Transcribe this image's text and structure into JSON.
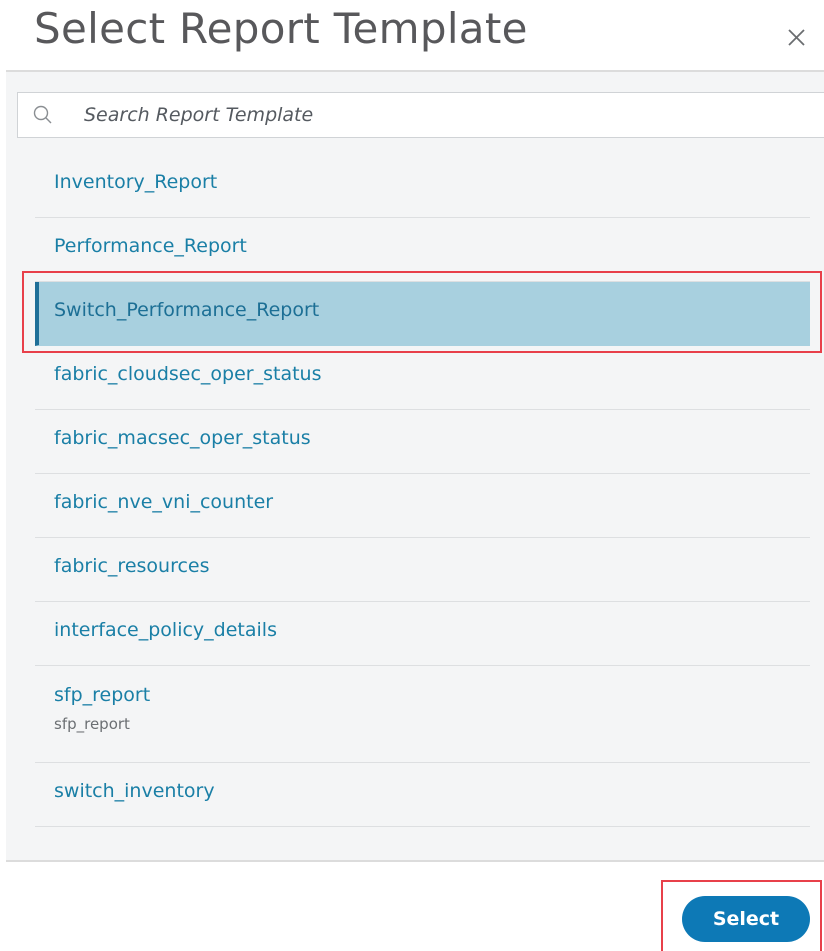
{
  "dialog": {
    "title": "Select Report Template",
    "close_icon": "close-icon"
  },
  "search": {
    "placeholder": "Search Report Template",
    "value": "",
    "icon": "search-icon"
  },
  "templates": [
    {
      "label": "Inventory_Report"
    },
    {
      "label": "Performance_Report"
    },
    {
      "label": "Switch_Performance_Report",
      "selected": true
    },
    {
      "label": "fabric_cloudsec_oper_status"
    },
    {
      "label": "fabric_macsec_oper_status"
    },
    {
      "label": "fabric_nve_vni_counter"
    },
    {
      "label": "fabric_resources"
    },
    {
      "label": "interface_policy_details"
    },
    {
      "label": "sfp_report",
      "description": "sfp_report"
    },
    {
      "label": "switch_inventory"
    }
  ],
  "footer": {
    "select_label": "Select"
  },
  "colors": {
    "accent": "#0d79b6",
    "selected_row": "#a8d0df",
    "link_text": "#1a7fa6",
    "annotation_red": "#e8404a"
  }
}
